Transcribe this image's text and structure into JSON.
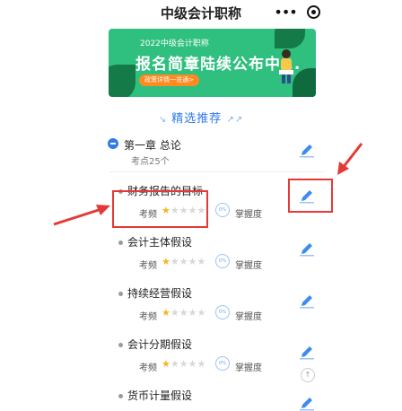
{
  "header": {
    "title": "中级会计职称",
    "more_icon": "more-dots-icon",
    "close_icon": "target-close-icon"
  },
  "banner": {
    "small_text": "2022中级会计职称",
    "headline": "报名简章陆续公布中...",
    "button_label": "政策详情一览通>",
    "bg_color": "#2fbf7e",
    "button_color": "#ff8a1f"
  },
  "section": {
    "left_deco": "↘",
    "title": "精选推荐",
    "right_deco": "↗↗",
    "color": "#2f7bea"
  },
  "chapter": {
    "label": "第一章 总论",
    "subtitle": "考点25个"
  },
  "items": [
    {
      "name": "财务报告的目标",
      "freq_label": "考频",
      "stars_on": "★",
      "stars_off": "★★★★",
      "gauge": "0%",
      "mastery_label": "掌握度"
    },
    {
      "name": "会计主体假设",
      "freq_label": "考频",
      "stars_on": "★",
      "stars_off": "★★★★",
      "gauge": "0%",
      "mastery_label": "掌握度"
    },
    {
      "name": "持续经营假设",
      "freq_label": "考频",
      "stars_on": "★",
      "stars_off": "★★★★",
      "gauge": "0%",
      "mastery_label": "掌握度"
    },
    {
      "name": "会计分期假设",
      "freq_label": "考频",
      "stars_on": "★",
      "stars_off": "★★★★",
      "gauge": "0%",
      "mastery_label": "掌握度"
    },
    {
      "name": "货币计量假设"
    }
  ],
  "scroll_top": "↑",
  "annotation_color": "#e53935"
}
